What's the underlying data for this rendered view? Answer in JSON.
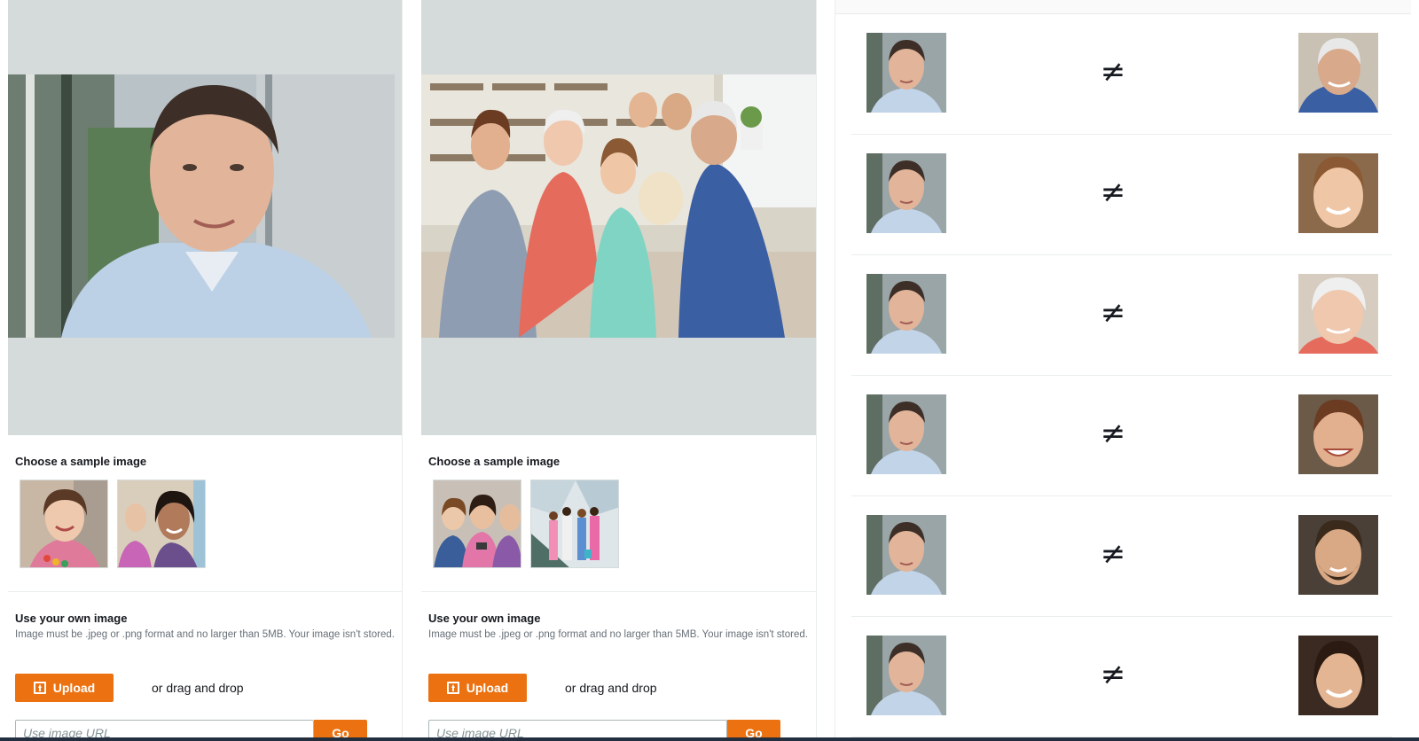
{
  "source_panel": {
    "sample_title": "Choose a sample image",
    "own_title": "Use your own image",
    "own_help": "Image must be .jpeg or .png format and no larger than 5MB. Your image isn't stored.",
    "upload_label": "Upload",
    "drag_text": "or drag and drop",
    "url_placeholder": "Use image URL",
    "go_label": "Go"
  },
  "target_panel": {
    "sample_title": "Choose a sample image",
    "own_title": "Use your own image",
    "own_help": "Image must be .jpeg or .png format and no larger than 5MB. Your image isn't stored.",
    "upload_label": "Upload",
    "drag_text": "or drag and drop",
    "url_placeholder": "Use image URL",
    "go_label": "Go"
  },
  "results": {
    "comparison_symbol": "≠",
    "rows": [
      {
        "symbol": "≠"
      },
      {
        "symbol": "≠"
      },
      {
        "symbol": "≠"
      },
      {
        "symbol": "≠"
      },
      {
        "symbol": "≠"
      },
      {
        "symbol": "≠"
      }
    ]
  },
  "colors": {
    "accent": "#ec7211",
    "preview_bg": "#d5dbdb",
    "text": "#16191f",
    "muted": "#687078"
  }
}
